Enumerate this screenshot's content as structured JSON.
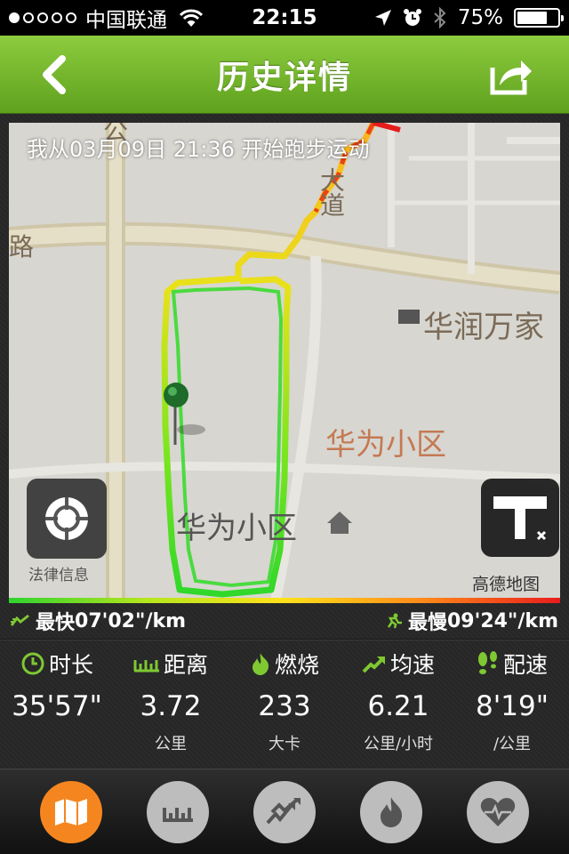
{
  "status": {
    "carrier": "中国联通",
    "time": "22:15",
    "battery": "75%",
    "battery_level": 0.75
  },
  "nav": {
    "title": "历史详情"
  },
  "map": {
    "start_info": "我从03月09日 21:36 开始跑步运动",
    "labels": {
      "huarun": "华润万家",
      "huawei_1": "华为小区",
      "huawei_2": "华为小区",
      "road": "大道",
      "road_left": "路",
      "top_left": "公"
    },
    "legal": "法律信息",
    "provider": "高德地图"
  },
  "pace": {
    "fastest_label": "最快",
    "fastest_value": "07'02\"/km",
    "slowest_label": "最慢",
    "slowest_value": "09'24\"/km"
  },
  "stats": [
    {
      "label": "时长",
      "value": "35'57\"",
      "unit": "",
      "icon": "clock-icon"
    },
    {
      "label": "距离",
      "value": "3.72",
      "unit": "公里",
      "icon": "ruler-icon"
    },
    {
      "label": "燃烧",
      "value": "233",
      "unit": "大卡",
      "icon": "flame-icon"
    },
    {
      "label": "均速",
      "value": "6.21",
      "unit": "公里/小时",
      "icon": "trend-icon"
    },
    {
      "label": "配速",
      "value": "8'19\"",
      "unit": "/公里",
      "icon": "footprints-icon"
    }
  ],
  "tabs": [
    {
      "name": "map-icon",
      "active": true
    },
    {
      "name": "ruler-icon",
      "active": false
    },
    {
      "name": "speed-chart-icon",
      "active": false
    },
    {
      "name": "flame-icon",
      "active": false
    },
    {
      "name": "heart-rate-icon",
      "active": false
    }
  ],
  "colors": {
    "nav_green": "#6fb12a",
    "accent_green": "#7ec832",
    "tab_active": "#f5861f"
  }
}
